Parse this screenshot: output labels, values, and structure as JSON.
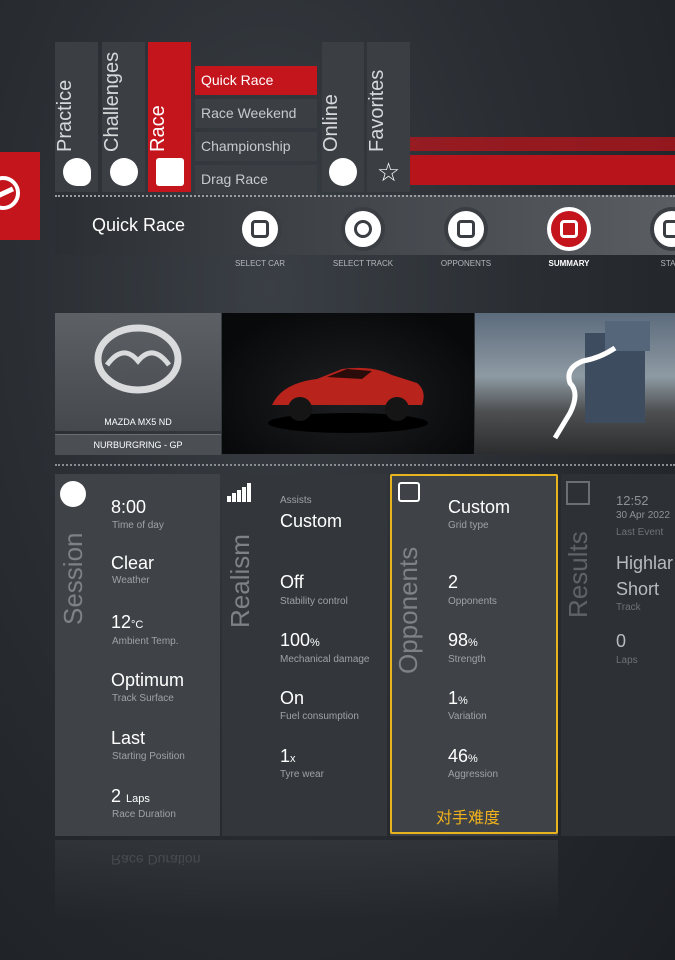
{
  "tabs": [
    {
      "label": "Practice",
      "icon": "helmet-icon"
    },
    {
      "label": "Challenges",
      "icon": "stopwatch-icon"
    },
    {
      "label": "Race",
      "icon": "podium-icon"
    },
    {
      "label": "Online",
      "icon": "online-car-icon"
    },
    {
      "label": "Favorites",
      "icon": "star-icon"
    }
  ],
  "race_submenu": [
    "Quick Race",
    "Race Weekend",
    "Championship",
    "Drag Race"
  ],
  "header": {
    "title": "Quick Race"
  },
  "steps": [
    "SELECT CAR",
    "SELECT TRACK",
    "OPPONENTS",
    "SUMMARY",
    "STA"
  ],
  "summary": {
    "car": "MAZDA MX5 ND",
    "track": "NURBURGRING - GP"
  },
  "session": {
    "title": "Session",
    "time_value": "8:00",
    "time_label": "Time of day",
    "weather_value": "Clear",
    "weather_label": "Weather",
    "temp_value": "12",
    "temp_unit": "°C",
    "temp_label": "Ambient Temp.",
    "surface_value": "Optimum",
    "surface_label": "Track Surface",
    "start_value": "Last",
    "start_label": "Starting Position",
    "duration_value": "2",
    "duration_unit": "Laps",
    "duration_label": "Race Duration"
  },
  "realism": {
    "title": "Realism",
    "assists_label": "Assists",
    "assists_value": "Custom",
    "stability_value": "Off",
    "stability_label": "Stability control",
    "damage_value": "100",
    "damage_unit": "%",
    "damage_label": "Mechanical damage",
    "fuel_value": "On",
    "fuel_label": "Fuel consumption",
    "tyre_value": "1",
    "tyre_unit": "x",
    "tyre_label": "Tyre wear"
  },
  "opponents": {
    "title": "Opponents",
    "grid_value": "Custom",
    "grid_label": "Grid type",
    "count_value": "2",
    "count_label": "Opponents",
    "strength_value": "98",
    "strength_unit": "%",
    "strength_label": "Strength",
    "variation_value": "1",
    "variation_unit": "%",
    "variation_label": "Variation",
    "aggression_value": "46",
    "aggression_unit": "%",
    "aggression_label": "Aggression",
    "annotation": "对手难度"
  },
  "results": {
    "title": "Results",
    "time": "12:52",
    "date": "30 Apr 2022",
    "event_label": "Last Event",
    "track_line1": "Highlar",
    "track_line2": "Short",
    "track_label": "Track",
    "laps_value": "0",
    "laps_label": "Laps"
  },
  "colors": {
    "accent": "#c4141c",
    "highlight": "#e7b31f",
    "panel": "#3f4347"
  }
}
